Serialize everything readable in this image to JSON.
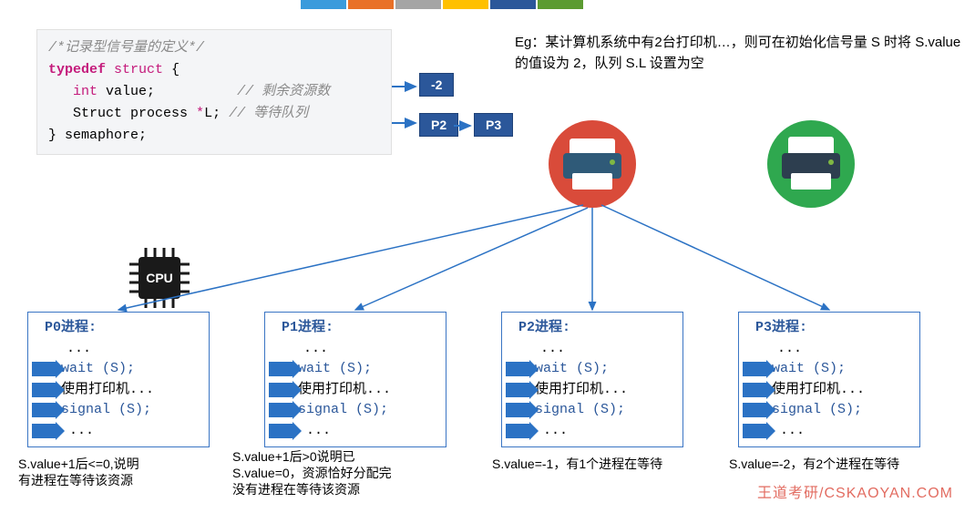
{
  "topbars": [
    "#3a9bdc",
    "#e97128",
    "#a5a5a5",
    "#ffc000",
    "#2b579a",
    "#5b9b31"
  ],
  "code": {
    "cmt0": "/*记录型信号量的定义*/",
    "line1_a": "typedef",
    "line1_b": "struct",
    "line1_c": " {",
    "line2_a": "int",
    "line2_b": " value;",
    "line2_cmt": "// 剩余资源数",
    "line3_a": "Struct process ",
    "line3_star": "*",
    "line3_b": "L;",
    "line3_cmt": "// 等待队列",
    "line4": "} semaphore;"
  },
  "boxes": {
    "val": "-2",
    "p2": "P2",
    "p3": "P3"
  },
  "eg": "Eg：某计算机系统中有2台打印机…，则可在初始化信号量 S 时将 S.value 的值设为 2，队列 S.L 设置为空",
  "cpu_label": "CPU",
  "procs": [
    {
      "title": "P0进程:",
      "wait": "wait (S);",
      "use": "使用打印机...",
      "signal": "signal (S);"
    },
    {
      "title": "P1进程:",
      "wait": "wait (S);",
      "use": "使用打印机...",
      "signal": "signal (S);"
    },
    {
      "title": "P2进程:",
      "wait": "wait (S);",
      "use": "使用打印机...",
      "signal": "signal (S);"
    },
    {
      "title": "P3进程:",
      "wait": "wait (S);",
      "use": "使用打印机...",
      "signal": "signal (S);"
    }
  ],
  "notes": [
    "S.value+1后<=0,说明\n有进程在等待该资源",
    "S.value+1后>0说明已\nS.value=0，资源恰好分配完\n没有进程在等待该资源",
    "S.value=-1，有1个进程在等待",
    "S.value=-2，有2个进程在等待"
  ],
  "watermark": "王道考研/CSKAOYAN.COM"
}
